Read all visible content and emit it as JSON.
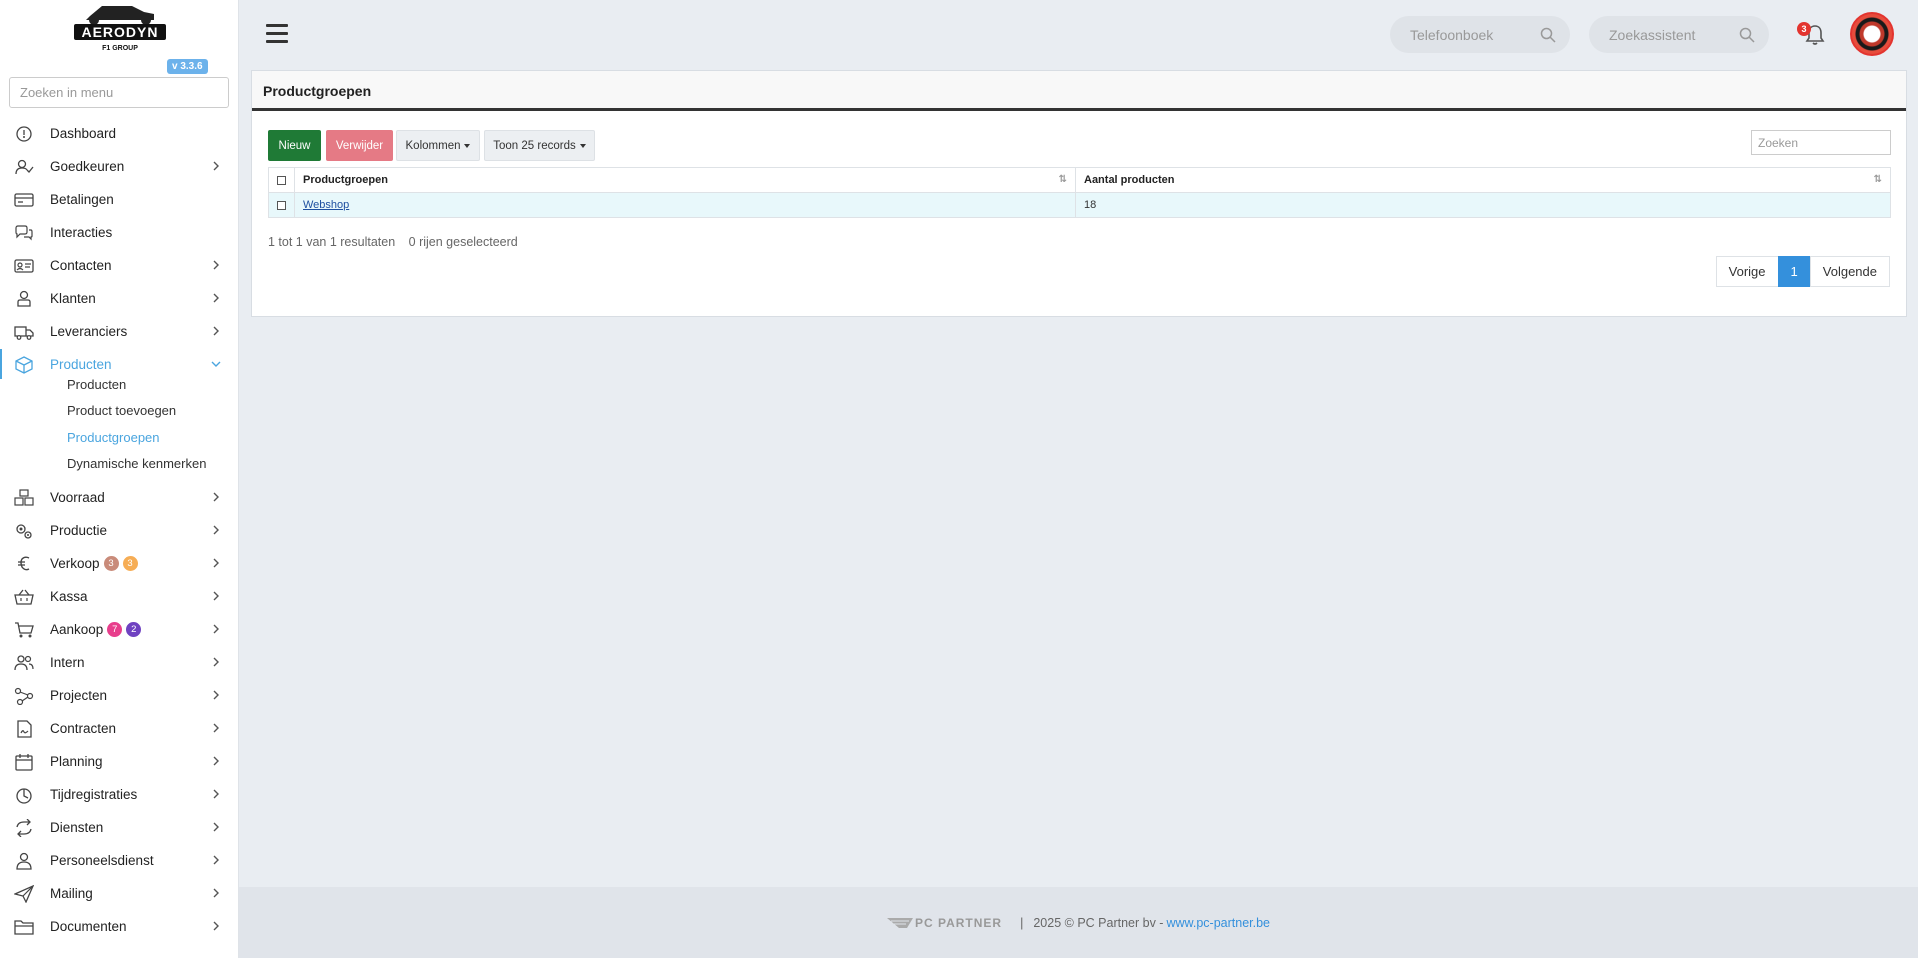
{
  "brand": {
    "logo_text": "AERODYN",
    "logo_sub": "F1 GROUP",
    "version": "v 3.3.6"
  },
  "sidebar": {
    "search_placeholder": "Zoeken in menu",
    "items": [
      {
        "label": "Dashboard",
        "icon": "dashboard-icon",
        "has_children": false
      },
      {
        "label": "Goedkeuren",
        "icon": "user-check-icon",
        "has_children": true
      },
      {
        "label": "Betalingen",
        "icon": "credit-card-icon",
        "has_children": false
      },
      {
        "label": "Interacties",
        "icon": "chat-icon",
        "has_children": false
      },
      {
        "label": "Contacten",
        "icon": "contact-card-icon",
        "has_children": true
      },
      {
        "label": "Klanten",
        "icon": "customer-icon",
        "has_children": true
      },
      {
        "label": "Leveranciers",
        "icon": "truck-icon",
        "has_children": true
      },
      {
        "label": "Producten",
        "icon": "box-icon",
        "has_children": true,
        "active": true
      },
      {
        "label": "Voorraad",
        "icon": "boxes-icon",
        "has_children": true
      },
      {
        "label": "Productie",
        "icon": "gears-icon",
        "has_children": true
      },
      {
        "label": "Verkoop",
        "icon": "euro-icon",
        "has_children": true
      },
      {
        "label": "Kassa",
        "icon": "basket-icon",
        "has_children": true
      },
      {
        "label": "Aankoop",
        "icon": "cart-icon",
        "has_children": true
      },
      {
        "label": "Intern",
        "icon": "users-icon",
        "has_children": true
      },
      {
        "label": "Projecten",
        "icon": "project-icon",
        "has_children": true
      },
      {
        "label": "Contracten",
        "icon": "contract-icon",
        "has_children": true
      },
      {
        "label": "Planning",
        "icon": "calendar-icon",
        "has_children": true
      },
      {
        "label": "Tijdregistraties",
        "icon": "timer-icon",
        "has_children": true
      },
      {
        "label": "Diensten",
        "icon": "refresh-icon",
        "has_children": true
      },
      {
        "label": "Personeelsdienst",
        "icon": "staff-icon",
        "has_children": true
      },
      {
        "label": "Mailing",
        "icon": "send-icon",
        "has_children": true
      },
      {
        "label": "Documenten",
        "icon": "folder-icon",
        "has_children": true
      }
    ],
    "producten_sub": [
      {
        "label": "Producten"
      },
      {
        "label": "Product toevoegen"
      },
      {
        "label": "Productgroepen",
        "active": true
      },
      {
        "label": "Dynamische kenmerken"
      }
    ],
    "badges": {
      "verkoop": [
        "3",
        "3"
      ],
      "aankoop": [
        "7",
        "2"
      ]
    }
  },
  "topbar": {
    "phonebook_placeholder": "Telefoonboek",
    "assistant_placeholder": "Zoekassistent",
    "notification_count": "3"
  },
  "card": {
    "title": "Productgroepen",
    "buttons": {
      "new": "Nieuw",
      "delete": "Verwijder",
      "columns": "Kolommen",
      "show": "Toon 25 records"
    },
    "search_placeholder": "Zoeken",
    "table": {
      "headers": [
        "Productgroepen",
        "Aantal producten"
      ],
      "rows": [
        {
          "name": "Webshop",
          "count": "18"
        }
      ]
    },
    "info": "1 tot 1 van 1 resultaten",
    "selected_info": "0 rijen geselecteerd",
    "pager": {
      "prev": "Vorige",
      "current": "1",
      "next": "Volgende"
    }
  },
  "footer": {
    "logo_text": "PC PARTNER",
    "copyright": "2025 © PC Partner bv - ",
    "link": "www.pc-partner.be"
  },
  "colors": {
    "accent": "#4aa5df",
    "new_button": "#1f7a36",
    "delete_button": "#e57a85",
    "page_active": "#3490dc",
    "badge_pink": "#e83e8c",
    "badge_purple": "#6f42c1",
    "badge_orange": "#f6ad55",
    "badge_brown": "#c98b7a"
  }
}
